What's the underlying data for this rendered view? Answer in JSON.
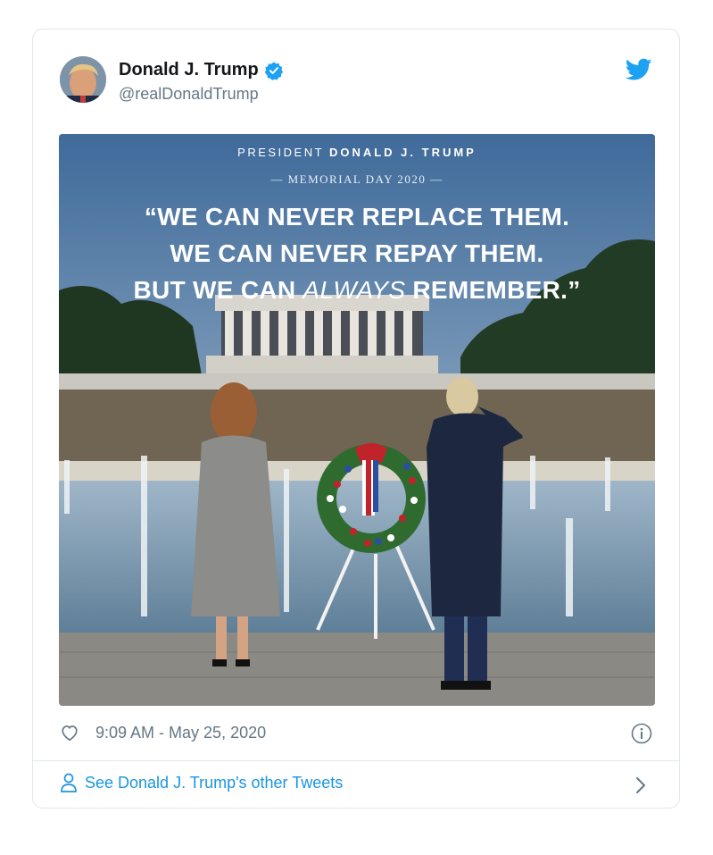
{
  "tweet": {
    "author_name": "Donald J. Trump",
    "author_handle": "@realDonaldTrump",
    "timestamp": "9:09 AM - May 25, 2020",
    "footer_link": "See Donald J. Trump's other Tweets"
  },
  "image": {
    "kicker_prefix": "PRESIDENT",
    "kicker_name": "DONALD J. TRUMP",
    "subkicker": "— MEMORIAL DAY 2020 —",
    "quote_line1": "“WE CAN NEVER REPLACE THEM.",
    "quote_line2": "WE CAN NEVER REPAY THEM.",
    "quote_line3_before": "BUT WE CAN ",
    "quote_line3_italic": "ALWAYS",
    "quote_line3_after": " REMEMBER.”"
  },
  "icons": {
    "verified": "verified-badge-icon",
    "bird": "twitter-bird-icon",
    "like": "heart-icon",
    "info": "info-icon",
    "profile": "person-icon",
    "chevron": "chevron-right-icon"
  },
  "colors": {
    "twitter_blue": "#1da1f2",
    "link_blue": "#1b95e0",
    "name_text": "#14171a",
    "secondary_text": "#657786",
    "border": "#e1e8ed"
  }
}
